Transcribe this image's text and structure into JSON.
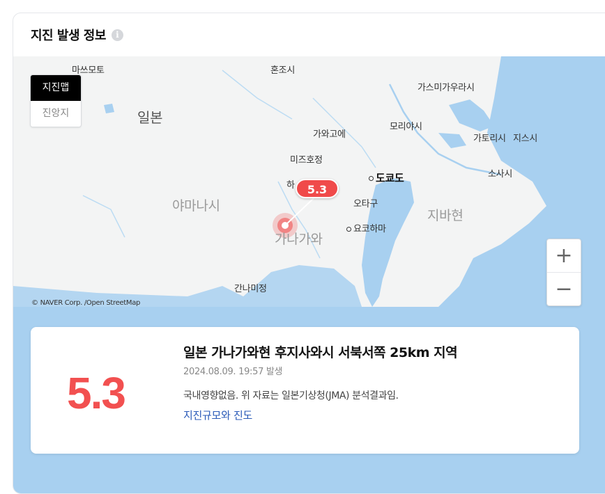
{
  "header": {
    "title": "지진 발생 정보",
    "info_icon": "info-icon",
    "info_glyph": "i"
  },
  "map": {
    "toggle": {
      "active": "지진맵",
      "inactive": "진앙지"
    },
    "labels": {
      "masumoto": "마쓰모토",
      "honjo": "혼조시",
      "kasumigaura": "가스미가우라시",
      "japan": "일본",
      "moriya": "모리야시",
      "kawagoe": "가와고에",
      "katori": "가토리시",
      "ajisu": "지스시",
      "mizuho": "미즈호정",
      "tokyo": "도쿄도",
      "choshi": "소사시",
      "ha": "하",
      "yamanashi": "야마나시",
      "ota": "오타구",
      "chiba": "지바현",
      "yokohama": "요코하마",
      "kanagawa": "가나가와",
      "kannami": "간나미정"
    },
    "bubble_value": "5.3",
    "copyright": "© NAVER Corp. /Open StreetMap",
    "zoom_in": "+",
    "zoom_out": "−",
    "colors": {
      "sea": "#a8d0f0",
      "land": "#f3f4f4",
      "epicenter": "#f04a4a"
    }
  },
  "card": {
    "magnitude": "5.3",
    "location": "일본 가나가와현 후지사와시 서북서쪽 25km 지역",
    "time": "2024.08.09. 19:57 발생",
    "note": "국내영향없음. 위 자료는 일본기상청(JMA) 분석결과임.",
    "link": "지진규모와 진도"
  }
}
